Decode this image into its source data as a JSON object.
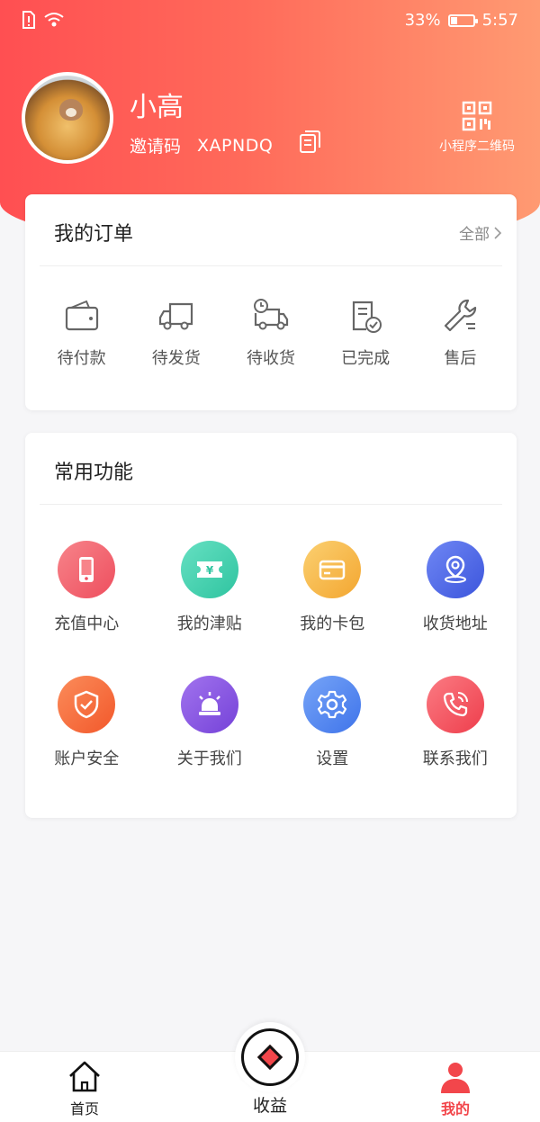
{
  "status_bar": {
    "battery": "33%",
    "time": "5:57"
  },
  "profile": {
    "name": "小高",
    "invite_label": "邀请码",
    "invite_code": "XAPNDQ",
    "qr_label": "小程序二维码"
  },
  "orders": {
    "title": "我的订单",
    "all_label": "全部",
    "items": [
      {
        "label": "待付款",
        "icon": "wallet-icon"
      },
      {
        "label": "待发货",
        "icon": "truck-icon"
      },
      {
        "label": "待收货",
        "icon": "delivery-truck-icon"
      },
      {
        "label": "已完成",
        "icon": "document-check-icon"
      },
      {
        "label": "售后",
        "icon": "wrench-icon"
      }
    ]
  },
  "functions": {
    "title": "常用功能",
    "items": [
      {
        "label": "充值中心",
        "icon": "phone-icon",
        "color": "#f05a66"
      },
      {
        "label": "我的津贴",
        "icon": "ticket-yen-icon",
        "color": "#3fcfae"
      },
      {
        "label": "我的卡包",
        "icon": "card-icon",
        "color": "#f6b040"
      },
      {
        "label": "收货地址",
        "icon": "location-icon",
        "color": "#4a62e6"
      },
      {
        "label": "账户安全",
        "icon": "shield-icon",
        "color": "#f86a3c"
      },
      {
        "label": "关于我们",
        "icon": "alarm-light-icon",
        "color": "#8a55e2"
      },
      {
        "label": "设置",
        "icon": "gear-icon",
        "color": "#4d84f2"
      },
      {
        "label": "联系我们",
        "icon": "phone-call-icon",
        "color": "#f25059"
      }
    ]
  },
  "tabbar": {
    "home": "首页",
    "earnings": "收益",
    "mine": "我的",
    "active_color": "#f2464b"
  }
}
